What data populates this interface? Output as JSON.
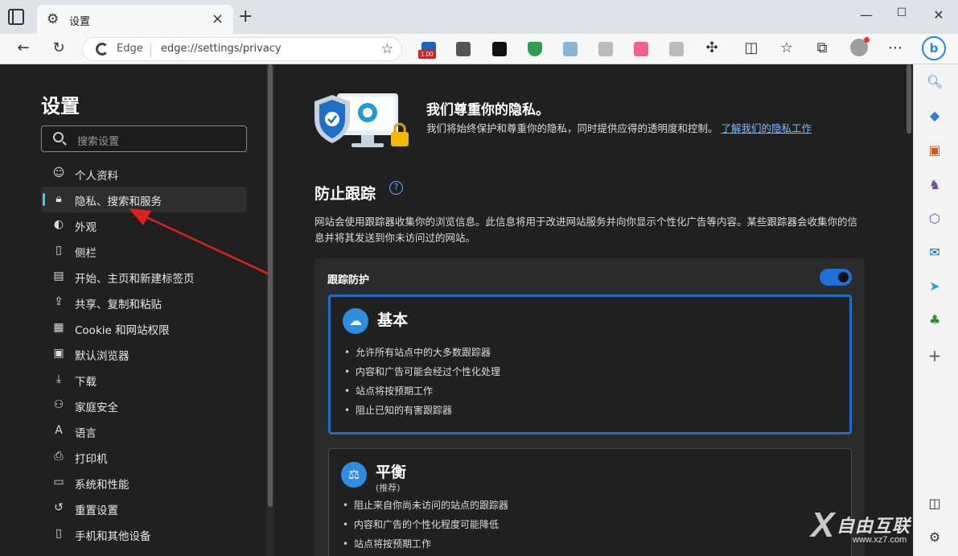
{
  "tab": {
    "title": "设置"
  },
  "window": {
    "minimize": "—",
    "maximize": "☐",
    "close": "✕"
  },
  "address": {
    "site": "Edge",
    "url": "edge://settings/privacy"
  },
  "extension_badge": "1.00",
  "nav": {
    "title": "设置",
    "search_placeholder": "搜索设置",
    "items": [
      {
        "label": "个人资料",
        "icon": "profile-icon",
        "glyph": "☺"
      },
      {
        "label": "隐私、搜索和服务",
        "icon": "lock-icon",
        "glyph": "🔒︎",
        "active": true
      },
      {
        "label": "外观",
        "icon": "palette-icon",
        "glyph": "◐"
      },
      {
        "label": "侧栏",
        "icon": "sidebar-icon",
        "glyph": "▯"
      },
      {
        "label": "开始、主页和新建标签页",
        "icon": "home-tab-icon",
        "glyph": "▤"
      },
      {
        "label": "共享、复制和粘贴",
        "icon": "share-icon",
        "glyph": "⇪"
      },
      {
        "label": "Cookie 和网站权限",
        "icon": "site-permissions-icon",
        "glyph": "▦"
      },
      {
        "label": "默认浏览器",
        "icon": "browser-icon",
        "glyph": "▣"
      },
      {
        "label": "下载",
        "icon": "download-icon",
        "glyph": "⤓"
      },
      {
        "label": "家庭安全",
        "icon": "family-icon",
        "glyph": "⚇"
      },
      {
        "label": "语言",
        "icon": "language-icon",
        "glyph": "A"
      },
      {
        "label": "打印机",
        "icon": "printer-icon",
        "glyph": "⎙"
      },
      {
        "label": "系统和性能",
        "icon": "system-icon",
        "glyph": "▭"
      },
      {
        "label": "重置设置",
        "icon": "reset-icon",
        "glyph": "↺"
      },
      {
        "label": "手机和其他设备",
        "icon": "phone-icon",
        "glyph": "▯"
      }
    ]
  },
  "privacy": {
    "title": "我们尊重你的隐私。",
    "desc": "我们将始终保护和尊重你的隐私，同时提供应得的透明度和控制。",
    "link": "了解我们的隐私工作"
  },
  "tracking": {
    "title": "防止跟踪",
    "desc": "网站会使用跟踪器收集你的浏览信息。此信息将用于改进网站服务并向你显示个性化广告等内容。某些跟踪器会收集你的信息并将其发送到你未访问过的网站。",
    "card_label": "跟踪防护",
    "toggle_on": true,
    "basic": {
      "title": "基本",
      "bullets": [
        "允许所有站点中的大多数跟踪器",
        "内容和广告可能会经过个性化处理",
        "站点将按预期工作",
        "阻止已知的有害跟踪器"
      ]
    },
    "balanced": {
      "title": "平衡",
      "sub": "(推荐)",
      "bullets": [
        "阻止来自你尚未访问的站点的跟踪器",
        "内容和广告的个性化程度可能降低",
        "站点将按预期工作"
      ]
    }
  },
  "watermark": {
    "text": "自由互联",
    "url": "www.xz7.com"
  },
  "colors": {
    "accent": "#1f6ec7",
    "arrow": "#e02020",
    "link": "#7cb9ff"
  }
}
